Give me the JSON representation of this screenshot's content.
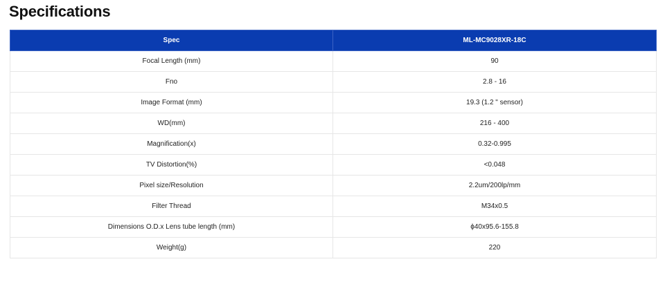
{
  "page": {
    "title": "Specifications"
  },
  "table": {
    "headers": [
      "Spec",
      "ML-MC9028XR-18C"
    ],
    "rows": [
      [
        "Focal Length (mm)",
        "90"
      ],
      [
        "Fno",
        "2.8 - 16"
      ],
      [
        "Image Format (mm)",
        "19.3 (1.2 \" sensor)"
      ],
      [
        "WD(mm)",
        "216 - 400"
      ],
      [
        "Magnification(x)",
        "0.32-0.995"
      ],
      [
        "TV Distortion(%)",
        "<0.048"
      ],
      [
        "Pixel size/Resolution",
        "2.2um/200lp/mm"
      ],
      [
        "Filter Thread",
        "M34x0.5"
      ],
      [
        "Dimensions O.D.x Lens tube length (mm)",
        "ϕ40x95.6-155.8"
      ],
      [
        "Weight(g)",
        "220"
      ]
    ]
  },
  "colors": {
    "header_bg": "#0a3cb0",
    "header_text": "#ffffff",
    "border": "#e6e6e6"
  }
}
